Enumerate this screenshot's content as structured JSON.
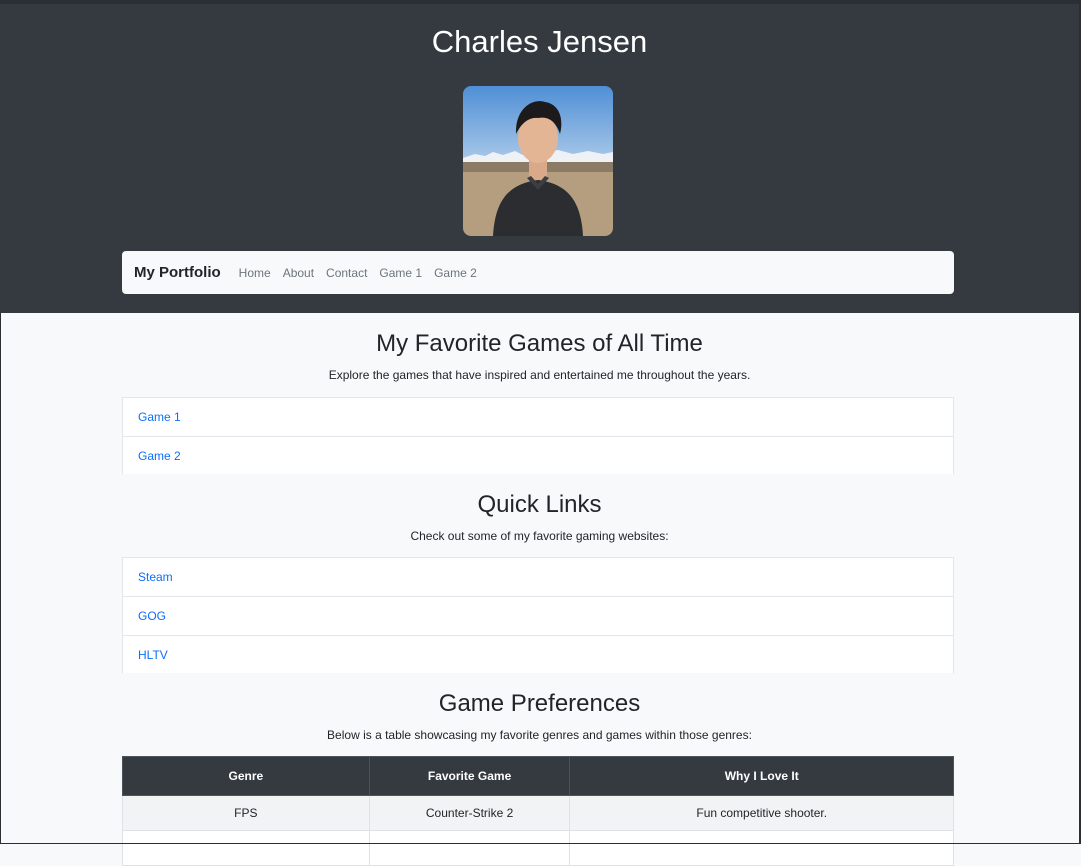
{
  "header": {
    "title": "Charles Jensen",
    "photo_alt": "Profile photo"
  },
  "navbar": {
    "brand": "My Portfolio",
    "links": [
      "Home",
      "About",
      "Contact",
      "Game 1",
      "Game 2"
    ]
  },
  "favorites": {
    "title": "My Favorite Games of All Time",
    "subtitle": "Explore the games that have inspired and entertained me throughout the years.",
    "items": [
      "Game 1",
      "Game 2"
    ]
  },
  "quick_links": {
    "title": "Quick Links",
    "subtitle": "Check out some of my favorite gaming websites:",
    "items": [
      "Steam",
      "GOG",
      "HLTV"
    ]
  },
  "preferences": {
    "title": "Game Preferences",
    "subtitle": "Below is a table showcasing my favorite genres and games within those genres:",
    "columns": [
      "Genre",
      "Favorite Game",
      "Why I Love It"
    ],
    "rows": [
      [
        "FPS",
        "Counter-Strike 2",
        "Fun competitive shooter."
      ],
      [
        "",
        "",
        ""
      ]
    ]
  },
  "colors": {
    "header_bg": "#343a40",
    "page_bg": "#f8f9fa",
    "link": "#0d6efd"
  }
}
